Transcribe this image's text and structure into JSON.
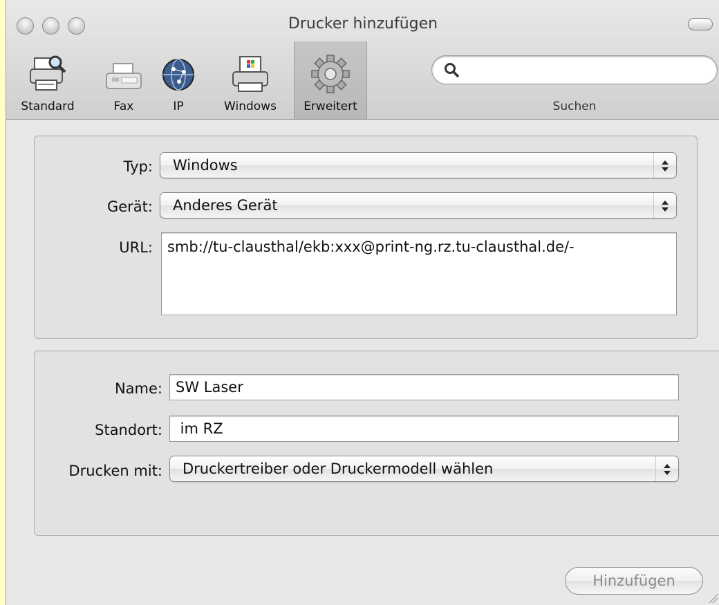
{
  "window": {
    "title": "Drucker hinzufügen"
  },
  "toolbar": {
    "items": [
      {
        "label": "Standard",
        "icon": "printer-search-icon",
        "selected": false
      },
      {
        "label": "Fax",
        "icon": "fax-icon",
        "selected": false
      },
      {
        "label": "IP",
        "icon": "globe-icon",
        "selected": false
      },
      {
        "label": "Windows",
        "icon": "windows-printer-icon",
        "selected": false
      },
      {
        "label": "Erweitert",
        "icon": "gear-icon",
        "selected": true
      }
    ],
    "search": {
      "value": "",
      "label": "Suchen",
      "icon": "magnifier-icon"
    }
  },
  "connection": {
    "typ_label": "Typ:",
    "typ_value": "Windows",
    "geraet_label": "Gerät:",
    "geraet_value": "Anderes Gerät",
    "url_label": "URL:",
    "url_value": "smb://tu-clausthal/ekb:xxx@print-ng.rz.tu-clausthal.de/-"
  },
  "details": {
    "name_label": "Name:",
    "name_value": "SW Laser",
    "standort_label": "Standort:",
    "standort_value": " im RZ",
    "drucken_label": "Drucken mit:",
    "drucken_value": "Druckertreiber oder Druckermodell wählen"
  },
  "actions": {
    "add_label": "Hinzufügen",
    "add_enabled": false
  }
}
